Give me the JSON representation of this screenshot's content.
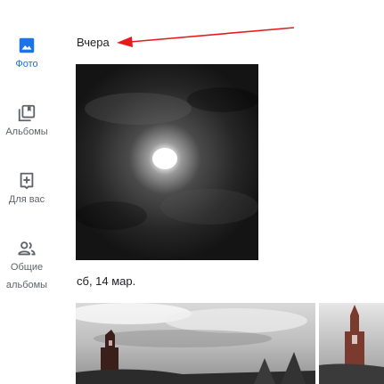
{
  "sidebar": {
    "items": [
      {
        "label": "Фото",
        "icon": "photo-icon",
        "active": true
      },
      {
        "label": "Альбомы",
        "icon": "albums-icon",
        "active": false
      },
      {
        "label": "Для вас",
        "icon": "for-you-icon",
        "active": false
      },
      {
        "label_line1": "Общие",
        "label_line2": "альбомы",
        "icon": "shared-albums-icon",
        "active": false
      }
    ]
  },
  "timeline": {
    "groups": [
      {
        "date": "Вчера",
        "photos": [
          {
            "subject": "moon-behind-clouds-bw"
          }
        ]
      },
      {
        "date": "сб, 14 мар.",
        "photos": [
          {
            "subject": "church-tower-cloudy-sky"
          },
          {
            "subject": "church-tower-cloudy-sky-2"
          }
        ]
      }
    ]
  },
  "colors": {
    "accent": "#1a73e8",
    "icon_gray": "#5f6368",
    "annotation_arrow": "#e8191e"
  }
}
